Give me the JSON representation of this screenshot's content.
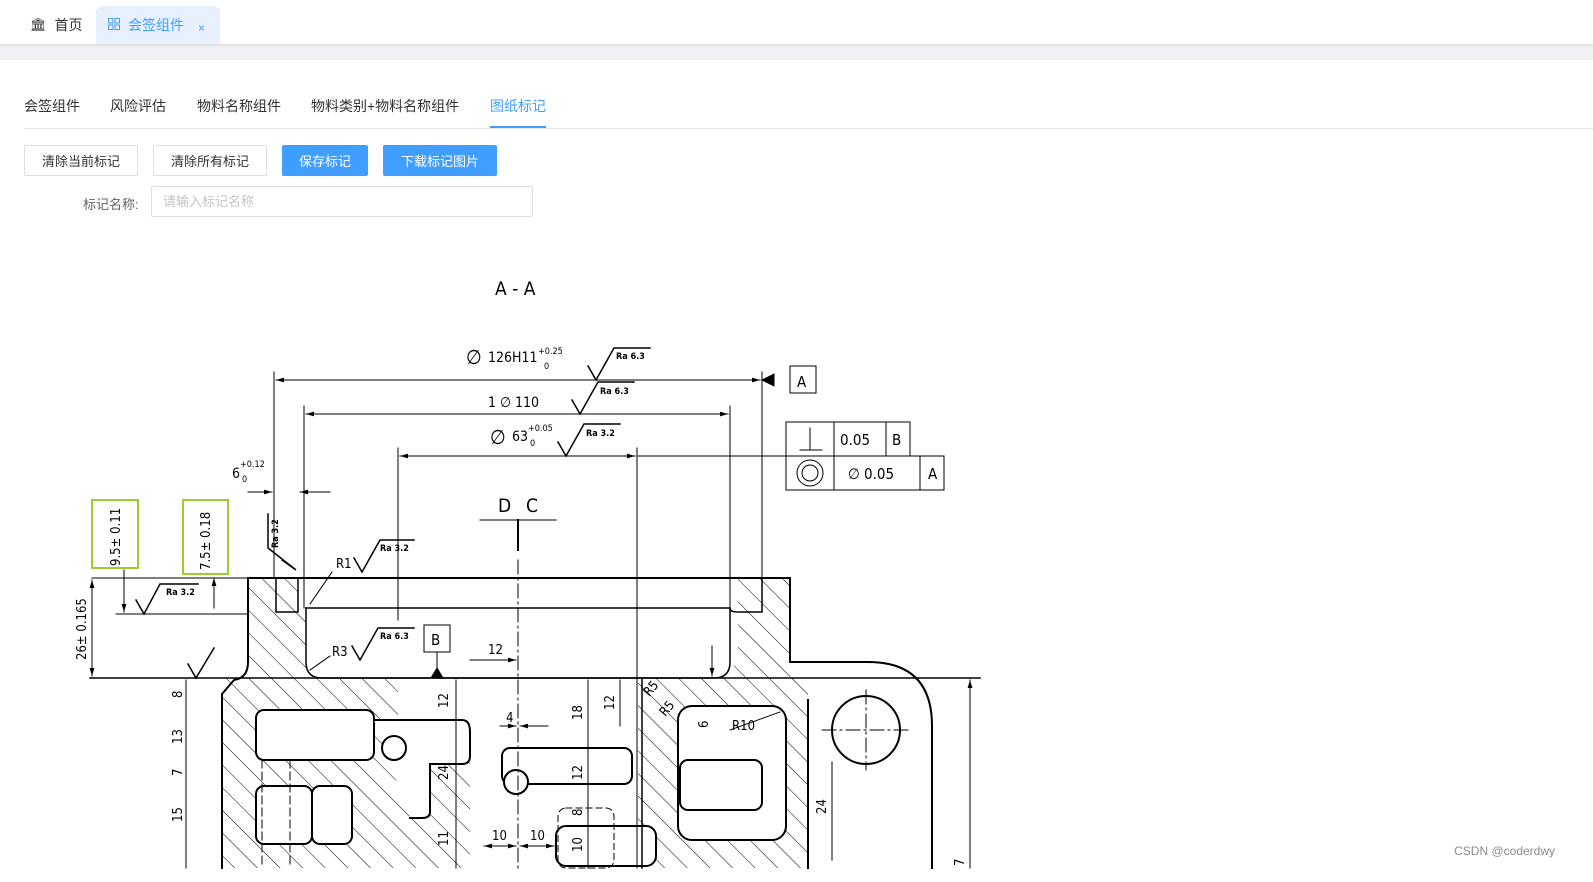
{
  "tabs": {
    "home_label": "首页",
    "active_label": "会签组件",
    "close_glyph": "×"
  },
  "subtabs": [
    "会签组件",
    "风险评估",
    "物料名称组件",
    "物料类别+物料名称组件",
    "图纸标记"
  ],
  "active_subtab": "图纸标记",
  "toolbar": {
    "clear_current": "清除当前标记",
    "clear_all": "清除所有标记",
    "save": "保存标记",
    "download": "下载标记图片"
  },
  "form": {
    "label": "标记名称:",
    "placeholder": "请输入标记名称",
    "value": ""
  },
  "drawing": {
    "section_title": "A - A",
    "dim_main_dia": "126H11",
    "dim_main_tol_upper": "+0.25",
    "dim_main_tol_lower": "0",
    "dim_110": "1 ∅ 110",
    "dim_63": "63",
    "dim_63_tol_upper": "+0.05",
    "dim_63_tol_lower": "0",
    "dim_6": "6",
    "dim_6_tol_upper": "+0.12",
    "dim_6_tol_lower": "0",
    "roughness_63": "Ra 6.3",
    "roughness_32": "Ra 3.2",
    "datum_a": "A",
    "datum_b": "B",
    "fcf_perp_value": "0.05",
    "fcf_conc_value": "∅ 0.05",
    "view_d": "D",
    "view_c": "C",
    "r1": "R1",
    "r3": "R3",
    "r5": "R5",
    "r10": "R10",
    "dim_26": "26± 0.165",
    "marked_dims": [
      "9.5± 0.11",
      "7.5± 0.18"
    ],
    "dims": {
      "d12a": "12",
      "d12b": "12",
      "d12c": "12",
      "d12d": "12",
      "d8": "8",
      "d13": "13",
      "d7": "7",
      "d15": "15",
      "d24a": "24",
      "d24b": "24",
      "d11": "11",
      "d10a": "10",
      "d10b": "10",
      "d10c": "10",
      "d18": "18",
      "d4": "4",
      "d6": "6",
      "d8b": "8",
      "d7b": "7"
    },
    "mark_color": "#9acd32"
  },
  "watermark": "CSDN @coderdwy",
  "colors": {
    "primary": "#409eff",
    "mark": "#9acd32"
  }
}
